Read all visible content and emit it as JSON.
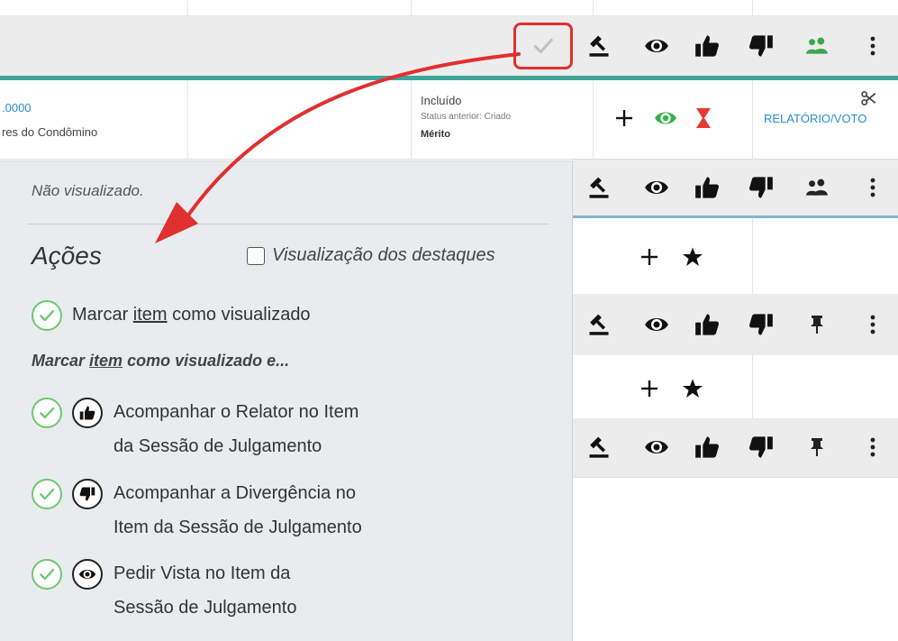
{
  "row1": {
    "amount": ".0000",
    "party": "res do Condômino",
    "status": "Incluído",
    "status_previous": "Status anterior: Criado",
    "category": "Mérito",
    "report_link": "RELATÓRIO/VOTO"
  },
  "panel": {
    "note": "Não visualizado.",
    "title": "Ações",
    "highlights_label": "Visualização dos destaques",
    "mark_prefix": "Marcar ",
    "mark_item": "item",
    "mark_suffix": " como visualizado",
    "sub_prefix": "Marcar ",
    "sub_item": "item",
    "sub_suffix": " como visualizado e...",
    "actions": [
      {
        "line1": "Acompanhar o Relator no Item",
        "line2": "da Sessão de Julgamento"
      },
      {
        "line1": "Acompanhar a Divergência no",
        "line2": "Item da Sessão de Julgamento"
      },
      {
        "line1": "Pedir Vista no Item da",
        "line2": "Sessão de Julgamento"
      }
    ]
  },
  "colors": {
    "accent_teal": "#3fa59b",
    "highlight_red": "#e0302f",
    "check_green": "#6cc96c",
    "link_blue": "#2a8ccf",
    "group_green": "#3aa64a"
  },
  "icons": [
    "check-icon",
    "gavel-icon",
    "eye-icon",
    "thumbs-up-icon",
    "thumbs-down-icon",
    "group-icon",
    "more-vertical-icon",
    "plus-icon",
    "hourglass-icon",
    "scissors-icon",
    "star-icon",
    "pin-icon"
  ]
}
